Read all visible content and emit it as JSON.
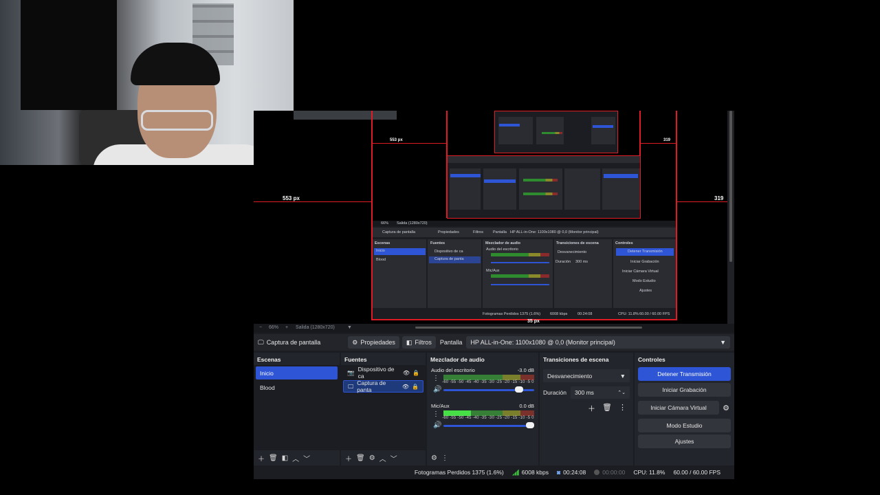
{
  "preview": {
    "measure_left": "553 px",
    "measure_right": "319",
    "measure_inner_left": "553 px",
    "measure_inner_right": "319",
    "measure_bottom": "35 px"
  },
  "zoombar": {
    "minus": "−",
    "zoom": "66%",
    "plus": "+",
    "output": "Salida (1280x720)",
    "caret": "▼"
  },
  "topbar": {
    "source_label": "Captura de pantalla",
    "properties": "Propiedades",
    "filters": "Filtros",
    "display_label": "Pantalla",
    "display_value": "HP ALL-in-One: 1100x1080 @ 0,0 (Monitor principal)"
  },
  "scenes": {
    "title": "Escenas",
    "items": [
      {
        "label": "Inicio",
        "active": true
      },
      {
        "label": "Blood",
        "active": false
      }
    ]
  },
  "sources": {
    "title": "Fuentes",
    "items": [
      {
        "label": "Dispositivo de ca",
        "icon": "camera-icon"
      },
      {
        "label": "Captura de panta",
        "icon": "monitor-icon"
      }
    ]
  },
  "mixer": {
    "title": "Mezclador de audio",
    "scale": "-60 -55 -50 -45 -40 -35 -30 -25 -20 -15 -10 -5 0",
    "channels": [
      {
        "name": "Audio del escritorio",
        "db": "-3.0 dB",
        "level": 0.0,
        "volume": 0.88
      },
      {
        "name": "Mic/Aux",
        "db": "0.0 dB",
        "level": 0.3,
        "volume": 1.0
      }
    ]
  },
  "transitions": {
    "title": "Transiciones de escena",
    "selected": "Desvanecimiento",
    "duration_label": "Duración",
    "duration_value": "300 ms"
  },
  "controls": {
    "title": "Controles",
    "stop_stream": "Detener Transmisión",
    "start_recording": "Iniciar Grabación",
    "start_virtual_cam": "Iniciar Cámara Virtual",
    "studio_mode": "Modo Estudio",
    "settings": "Ajustes"
  },
  "status": {
    "dropped_frames": "Fotogramas Perdidos 1375 (1.6%)",
    "bitrate": "6008 kbps",
    "stream_time": "00:24:08",
    "record_time": "00:00:00",
    "cpu": "CPU: 11.8%",
    "fps": "60.00 / 60.00 FPS"
  },
  "nested": {
    "source_label": "Captura de pantalla",
    "properties": "Propiedades",
    "filters": "Filtros",
    "display_label": "Pantalla",
    "display_value": "HP ALL-in-One: 1100x1080 @ 0,0 (Monitor principal)",
    "scenes_title": "Escenas",
    "scene1": "Inicio",
    "scene2": "Blood",
    "sources_title": "Fuentes",
    "source1": "Dispositivo de ca",
    "source2": "Captura de panta",
    "mixer_title": "Mezclador de audio",
    "ch1": "Audio del escritorio",
    "ch2": "Mic/Aux",
    "trans_title": "Transiciones de escena",
    "trans_sel": "Desvanecimiento",
    "duration": "Duración",
    "duration_val": "300 ms",
    "ctrl_title": "Controles",
    "stop": "Detener Transmisión",
    "rec": "Iniciar Grabación",
    "vcam": "Iniciar Cámara Virtual",
    "studio": "Modo Estudio",
    "settings": "Ajustes",
    "status": "Fotogramas Perdidos 1375 (1.6%)",
    "bitrate": "6008 kbps",
    "time": "00:24:08",
    "cpu": "CPU: 11.8%",
    "fps": "60.00 / 60.00 FPS",
    "zoom": "66%",
    "output": "Salida (1280x720)"
  },
  "colors": {
    "accent": "#2d55d6",
    "panel": "#22252b",
    "guide": "#e01b24"
  }
}
